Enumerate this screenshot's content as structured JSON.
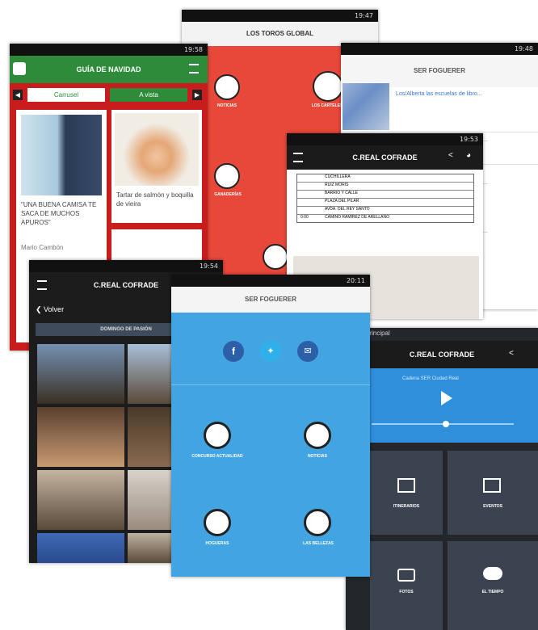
{
  "screens": {
    "toros": {
      "time": "19:47",
      "title": "LOS TOROS GLOBAL",
      "items": [
        "NOTICIAS",
        "LOS CARTELES",
        "GANADERÍAS"
      ],
      "bg": "#e8483a"
    },
    "guia": {
      "time": "19:58",
      "title": "GUÍA DE NAVIDAD",
      "tabs": [
        "Carrusel",
        "A vista"
      ],
      "card1": "\"UNA BUENA CAMISA TE SACA DE MUCHOS APUROS\"",
      "card1_author": "Mario Cambón",
      "card2": "Tartar de salmón y boquilla de vieira",
      "accent": "#2e8b3a",
      "red": "#c91d1d"
    },
    "foguerer_back": {
      "time": "19:48",
      "title": "SER FOGUERER",
      "news": [
        "Los/Alberta las escuelas de libro...",
        "...",
        "...",
        "..."
      ]
    },
    "creal_table": {
      "time": "19:53",
      "title": "C.REAL COFRADE",
      "rows": [
        "CUCHILLERA",
        "RUIZ MORIS",
        "BARRIO Y CALLE",
        "PLAZA DEL PILAR",
        "AVDA. DEL REY SANTO",
        "CAMINO RAMÍREZ DE ARELLANO"
      ],
      "row7_code": "0:00"
    },
    "creal_gallery": {
      "time": "19:54",
      "title": "C.REAL COFRADE",
      "back": "Volver",
      "section": "DOMINGO DE PASIÓN"
    },
    "foguerer_front": {
      "time": "20:11",
      "title": "SER FOGUERER",
      "items": [
        "CONCURSO ACTUALIDAD",
        "NOTICIAS",
        "HOGUERAS",
        "LAS BELLEZAS"
      ],
      "bg": "#42a4e0"
    },
    "creal_player": {
      "title": "C.REAL COFRADE",
      "top": "Principal",
      "subtitle": "Cadena SER Ciudad Real",
      "tiles": [
        "ITINERARIOS",
        "EVENTOS",
        "FOTOS",
        "EL TIEMPO"
      ],
      "bg": "#2f8fdb"
    }
  }
}
